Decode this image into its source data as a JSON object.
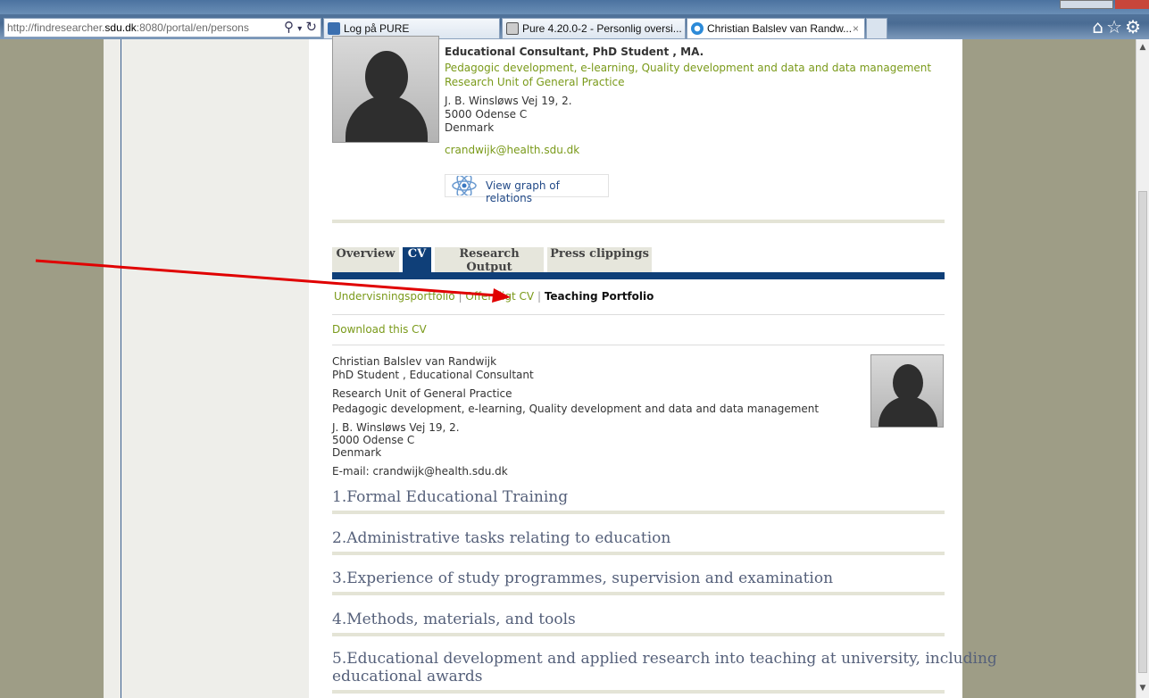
{
  "browser": {
    "url_prefix": "http://findresearcher.",
    "url_host": "sdu.dk",
    "url_rest": ":8080/portal/en/persons",
    "tabs": [
      {
        "label": "Log på PURE"
      },
      {
        "label": "Pure 4.20.0-2 - Personlig oversi..."
      },
      {
        "label": "Christian Balslev van Randw...",
        "close": "×"
      }
    ]
  },
  "profile": {
    "title": "Educational Consultant, PhD Student , MA.",
    "interests": "Pedagogic development, e-learning, Quality development and data and data management",
    "unit": "Research Unit of General Practice",
    "address": [
      "J. B. Winsløws Vej 19, 2.",
      "5000 Odense C",
      "Denmark"
    ],
    "email": "crandwijk@health.sdu.dk",
    "graph_button": "View graph of relations"
  },
  "tabs": [
    {
      "label": "Overview"
    },
    {
      "label": "CV"
    },
    {
      "label": "Research Output"
    },
    {
      "label": "Press clippings"
    }
  ],
  "subnav": {
    "item1": "Undervisningsportfolio",
    "sep": "|",
    "item2": "Offentligt CV",
    "item3": "Teaching Portfolio"
  },
  "download": "Download this CV",
  "cv": {
    "name": "Christian Balslev van Randwijk",
    "role": "PhD Student , Educational Consultant",
    "unit": "Research Unit of General Practice",
    "interests": "Pedagogic development, e-learning, Quality development and data and data management",
    "address": [
      "J. B. Winsløws Vej 19, 2.",
      "5000 Odense C",
      "Denmark"
    ],
    "email": "E-mail: crandwijk@health.sdu.dk"
  },
  "sections": [
    "1.Formal Educational Training",
    "2.Administrative tasks relating to education",
    "3.Experience of study programmes, supervision and examination",
    "4.Methods, materials, and tools",
    "5.Educational development and applied research into teaching at university, including",
    "educational awards"
  ],
  "colors": {
    "accent": "#0f3f78",
    "link": "#7a9a1a",
    "annotation": "#e00000"
  },
  "icons": [
    "search-icon",
    "refresh-icon",
    "home-icon",
    "star-icon",
    "gear-icon",
    "atom-icon"
  ]
}
